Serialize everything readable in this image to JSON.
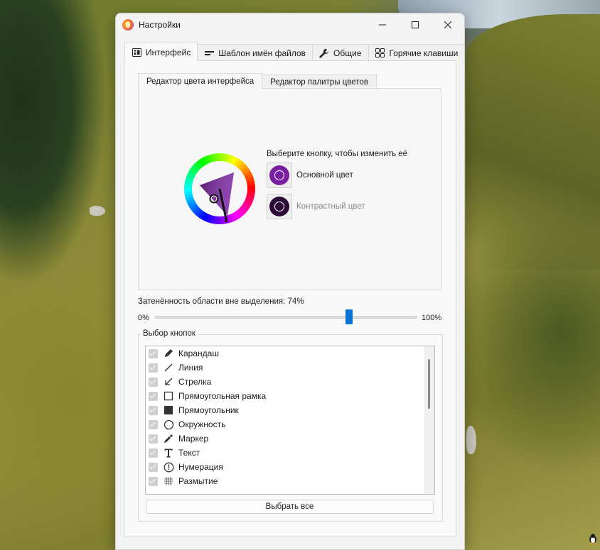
{
  "window": {
    "title": "Настройки"
  },
  "tabs": [
    {
      "label": "Интерфейс",
      "icon": "interface-icon",
      "active": true
    },
    {
      "label": "Шаблон имён файлов",
      "icon": "filename-template-icon",
      "active": false
    },
    {
      "label": "Общие",
      "icon": "wrench-icon",
      "active": false
    },
    {
      "label": "Горячие клавиши",
      "icon": "hotkeys-grid-icon",
      "active": false
    }
  ],
  "subtabs": [
    {
      "label": "Редактор цвета интерфейса",
      "active": true
    },
    {
      "label": "Редактор палитры цветов",
      "active": false
    }
  ],
  "color_editor": {
    "hint": "Выберите кнопку, чтобы изменить её",
    "primary_label": "Основной цвет",
    "primary_color": "#7a1fa2",
    "contrast_label": "Контрастный цвет",
    "contrast_color": "#2a0a35"
  },
  "opacity": {
    "label": "Затенённость области вне выделения: 74%",
    "min_label": "0%",
    "max_label": "100%",
    "value_percent": 74
  },
  "buttons_group": {
    "title": "Выбор кнопок",
    "items": [
      {
        "label": "Карандаш",
        "icon": "pencil-icon"
      },
      {
        "label": "Линия",
        "icon": "line-icon"
      },
      {
        "label": "Стрелка",
        "icon": "arrow-icon"
      },
      {
        "label": "Прямоугольная рамка",
        "icon": "rect-outline-icon"
      },
      {
        "label": "Прямоугольник",
        "icon": "rect-filled-icon"
      },
      {
        "label": "Окружность",
        "icon": "circle-icon"
      },
      {
        "label": "Маркер",
        "icon": "marker-icon"
      },
      {
        "label": "Текст",
        "icon": "text-icon"
      },
      {
        "label": "Нумерация",
        "icon": "numbering-icon"
      },
      {
        "label": "Размытие",
        "icon": "blur-icon"
      }
    ],
    "select_all": "Выбрать все"
  },
  "colors": {
    "accent": "#0a74d6",
    "window_bg": "#f3f3f3"
  }
}
